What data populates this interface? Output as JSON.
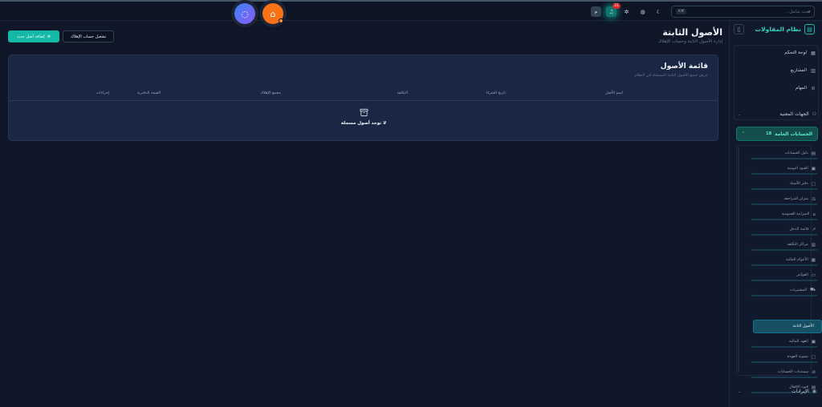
{
  "header": {
    "search_placeholder": "بحث شامل...",
    "search_shortcut": "⌘K",
    "notification_count": "21",
    "avatar_initial": "م"
  },
  "sidebar": {
    "brand": "نظام المقاولات",
    "top_items": [
      {
        "label": "لوحة التحكم",
        "icon": "grid-icon"
      },
      {
        "label": "المشاريع",
        "icon": "building-icon"
      },
      {
        "label": "المهام",
        "icon": "check-circle-icon"
      }
    ],
    "section_stakeholders": "الجهات المعنية",
    "section_accounts": "الحسابات العامة",
    "section_accounts_count": "18",
    "account_items": [
      "دليل الحسابات",
      "القيود اليومية",
      "دفتر الأستاذ",
      "ميزان المراجعة",
      "الميزانية العمومية",
      "قائمة الدخل",
      "مراكز التكلفة",
      "الأعوام المالية",
      "الفواتير",
      "المشتريات",
      "الأصول الثابتة",
      "العهد المالية",
      "تسوية العهدة",
      "مستندات الحسابات",
      "قيود الإقفال"
    ],
    "active_account_item": "الأصول الثابتة",
    "section_revenues": "الإيرادات"
  },
  "page": {
    "title": "الأصول الثابتة",
    "subtitle": "إدارة الأصول الثابتة وحساب الإهلاك",
    "add_button": "إضافة أصل جديد",
    "depreciation_button": "تشغيل حساب الإهلاك"
  },
  "card": {
    "title": "قائمة الأصول",
    "subtitle": "عرض جميع الأصول الثابتة المسجلة في النظام",
    "columns": [
      "اسم الأصل",
      "تاريخ الشراء",
      "التكلفة",
      "مجمع الإهلاك",
      "القيمة الدفترية",
      "إجراءات"
    ],
    "empty_message": "لا توجد أصول مسجلة"
  },
  "colors": {
    "accent": "#14b8a6",
    "background": "#0f1729",
    "card": "#1a2744",
    "chat_button": "#6366f1",
    "bot_button": "#f97316"
  }
}
